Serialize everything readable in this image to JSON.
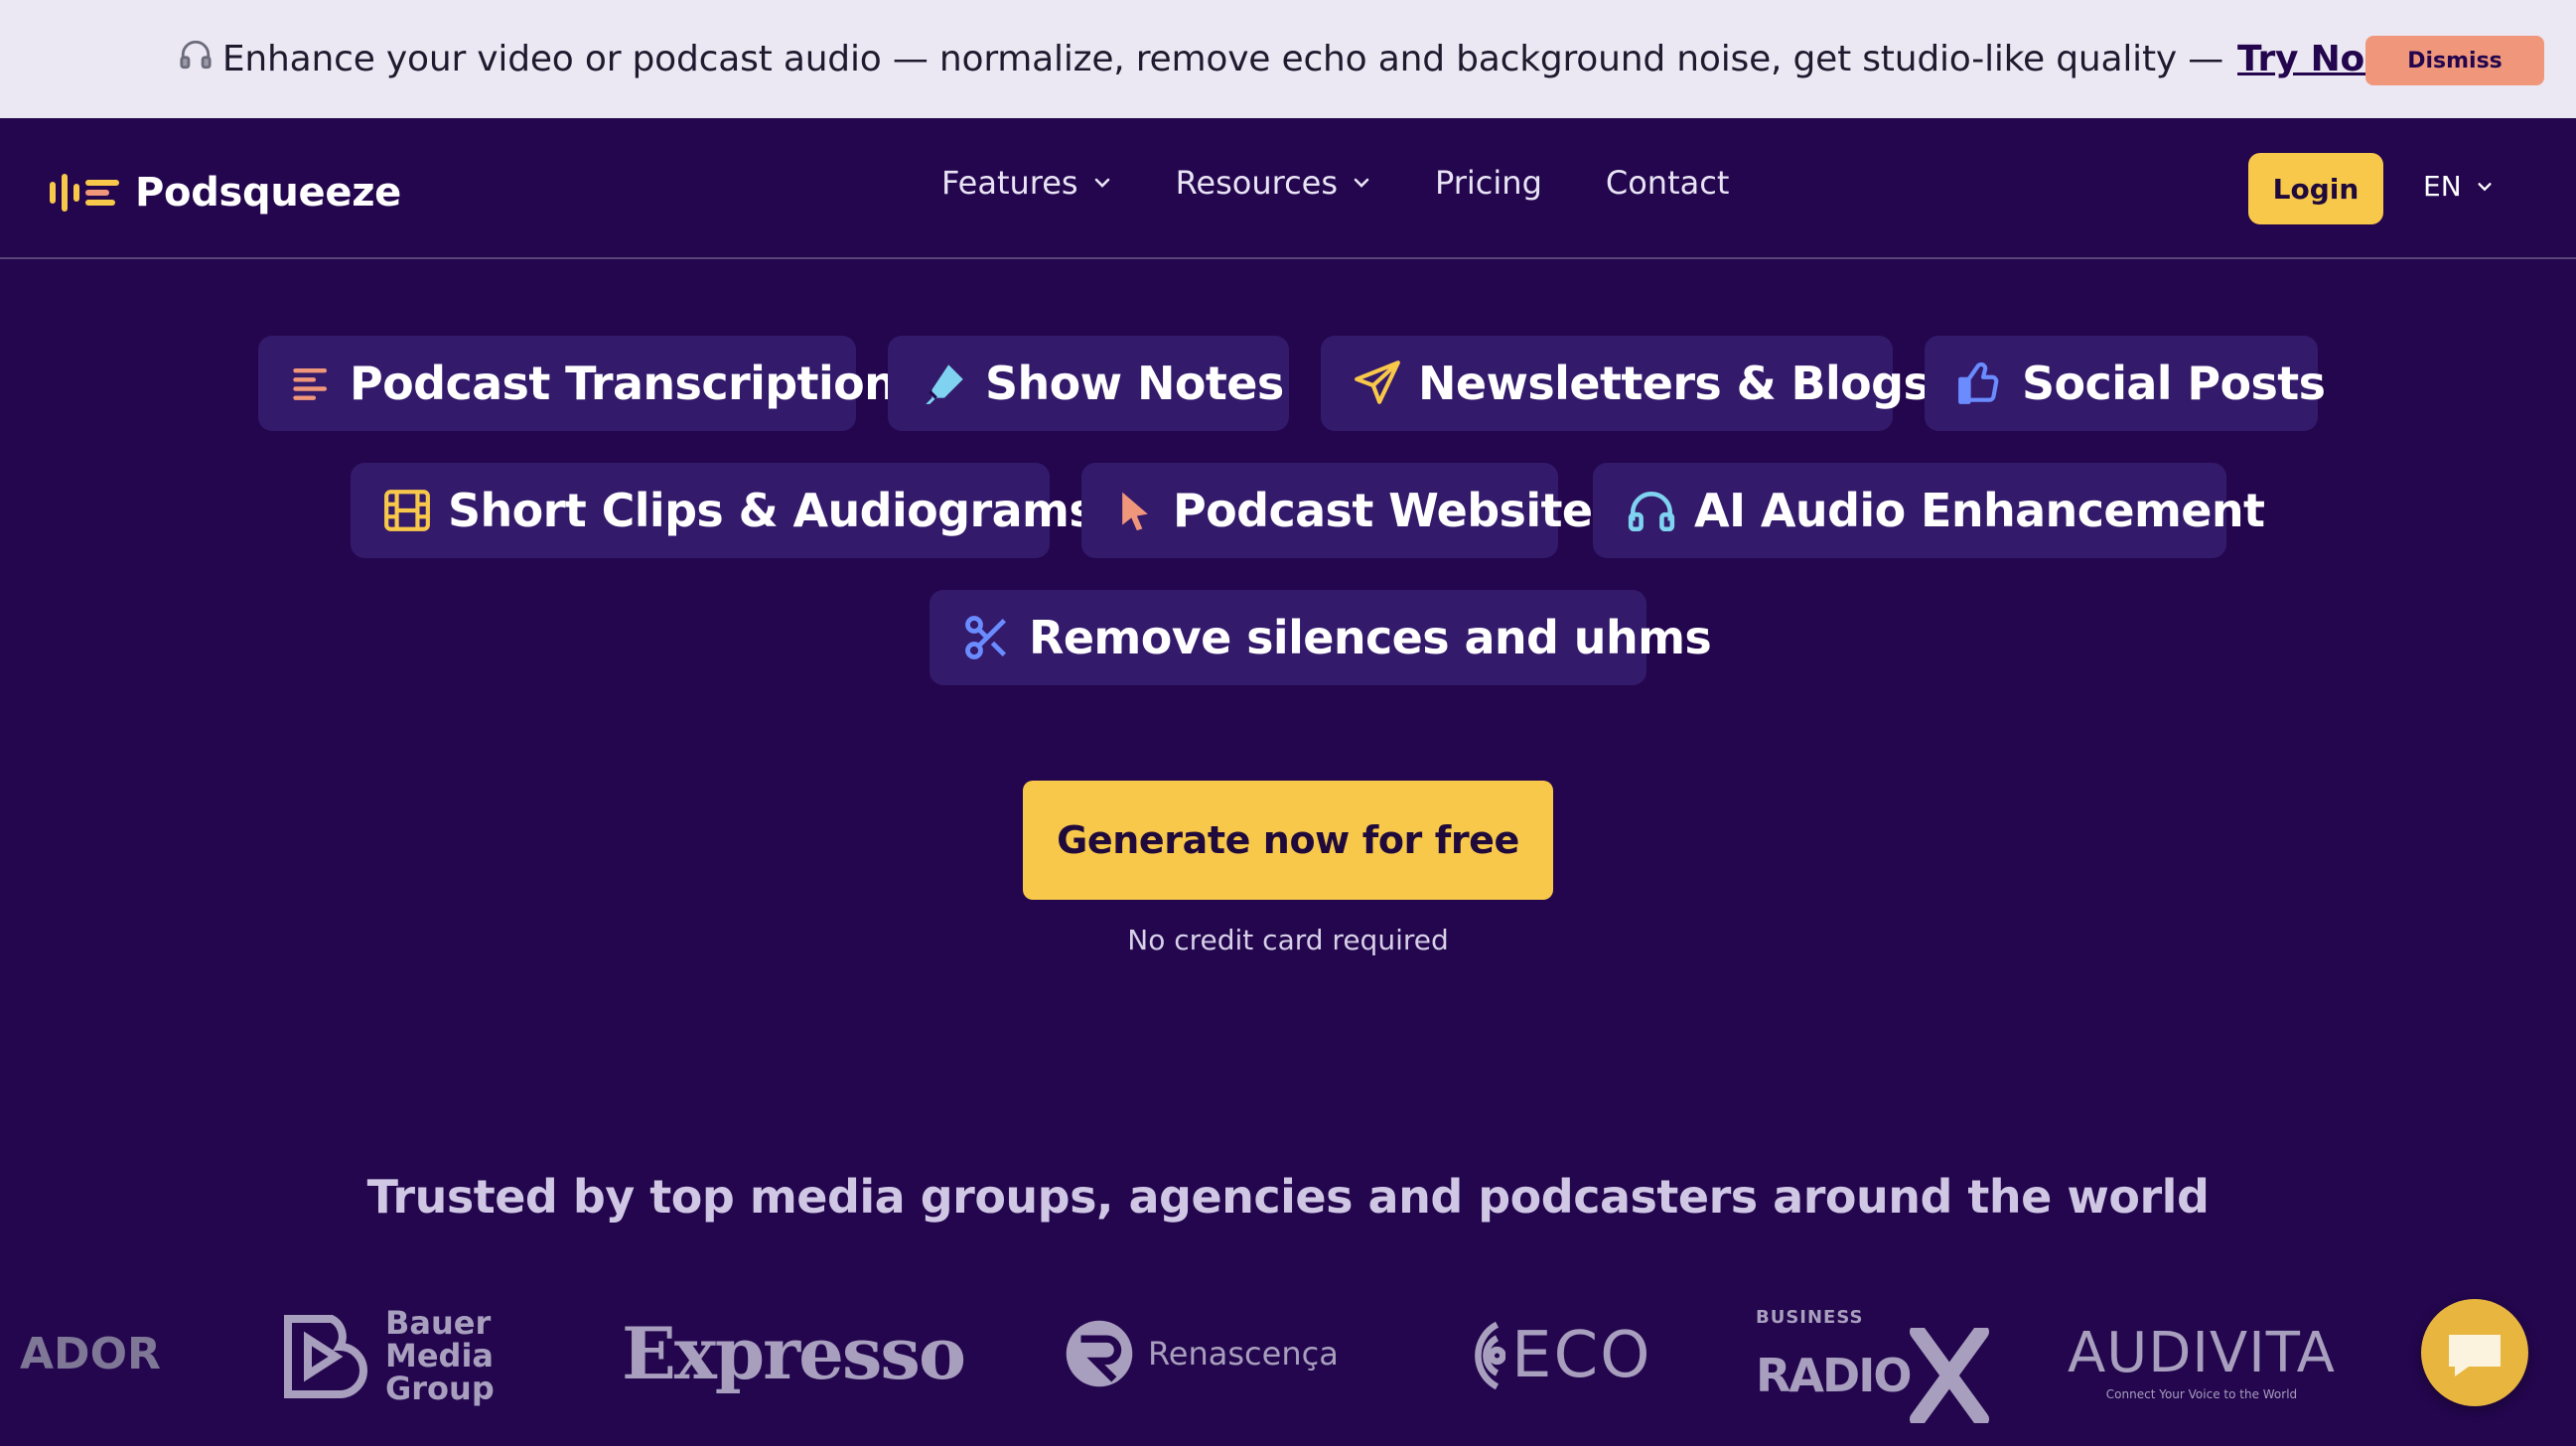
{
  "banner": {
    "icon": "headphones-icon",
    "text": "Enhance your video or podcast audio — normalize, remove echo and background noise, get studio-like quality —",
    "link": "Try Now",
    "dismiss": "Dismiss"
  },
  "nav": {
    "brand": "Podsqueeze",
    "links": [
      "Features",
      "Resources",
      "Pricing",
      "Contact"
    ],
    "login": "Login",
    "language": "EN"
  },
  "features": [
    {
      "label": "Podcast Transcription",
      "icon": "lines-icon"
    },
    {
      "label": "Show Notes",
      "icon": "highlighter-icon"
    },
    {
      "label": "Newsletters & Blogs",
      "icon": "paper-plane-icon"
    },
    {
      "label": "Social Posts",
      "icon": "thumbs-up-icon"
    },
    {
      "label": "Short Clips & Audiograms",
      "icon": "film-icon"
    },
    {
      "label": "Podcast Website",
      "icon": "cursor-icon"
    },
    {
      "label": "AI Audio Enhancement",
      "icon": "headphones-icon"
    },
    {
      "label": "Remove silences and uhms",
      "icon": "scissors-icon"
    }
  ],
  "cta": {
    "button": "Generate now for free",
    "note": "No credit card required"
  },
  "trusted": {
    "heading": "Trusted by top media groups, agencies and podcasters around the world",
    "logos": [
      "ADOR",
      "Bauer Media Group",
      "Expresso",
      "Renascença",
      "ECO",
      "BUSINESS RADIO X",
      "AUDIVITA"
    ],
    "audivita_tagline": "Connect Your Voice to the World",
    "bauer_lines": [
      "Bauer",
      "Media",
      "Group"
    ],
    "radio_small": "BUSINESS",
    "radio_big": "RADIO"
  },
  "colors": {
    "background": "#23064d",
    "chip": "#331a6b",
    "accent_yellow": "#f8c84a",
    "dismiss": "#f0977b",
    "banner_bg": "#ebe8f3"
  }
}
